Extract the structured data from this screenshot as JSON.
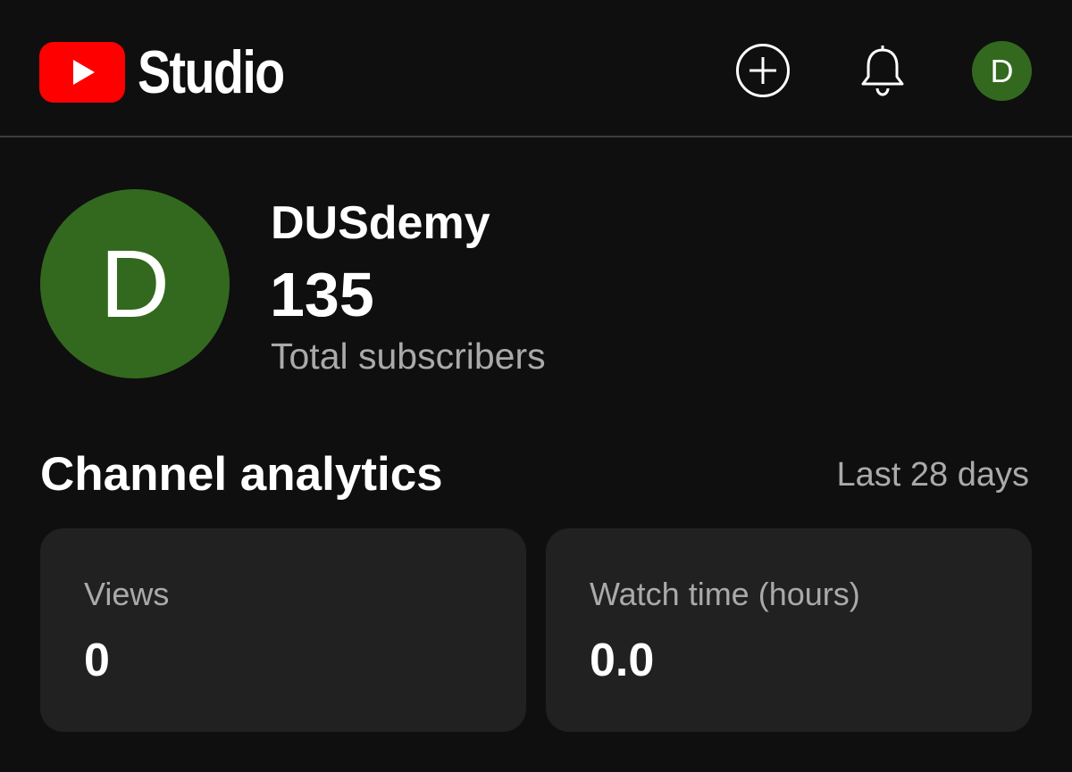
{
  "header": {
    "logo_text": "Studio",
    "create_icon": "plus-circle-icon",
    "notifications_icon": "bell-icon",
    "account_initial": "D",
    "brand_color": "#ff0000"
  },
  "channel": {
    "avatar_initial": "D",
    "avatar_color": "#33691e",
    "name": "DUSdemy",
    "subscriber_count": "135",
    "subscriber_label": "Total subscribers"
  },
  "analytics": {
    "title": "Channel analytics",
    "period": "Last 28 days",
    "cards": [
      {
        "label": "Views",
        "value": "0"
      },
      {
        "label": "Watch time (hours)",
        "value": "0.0"
      }
    ]
  }
}
